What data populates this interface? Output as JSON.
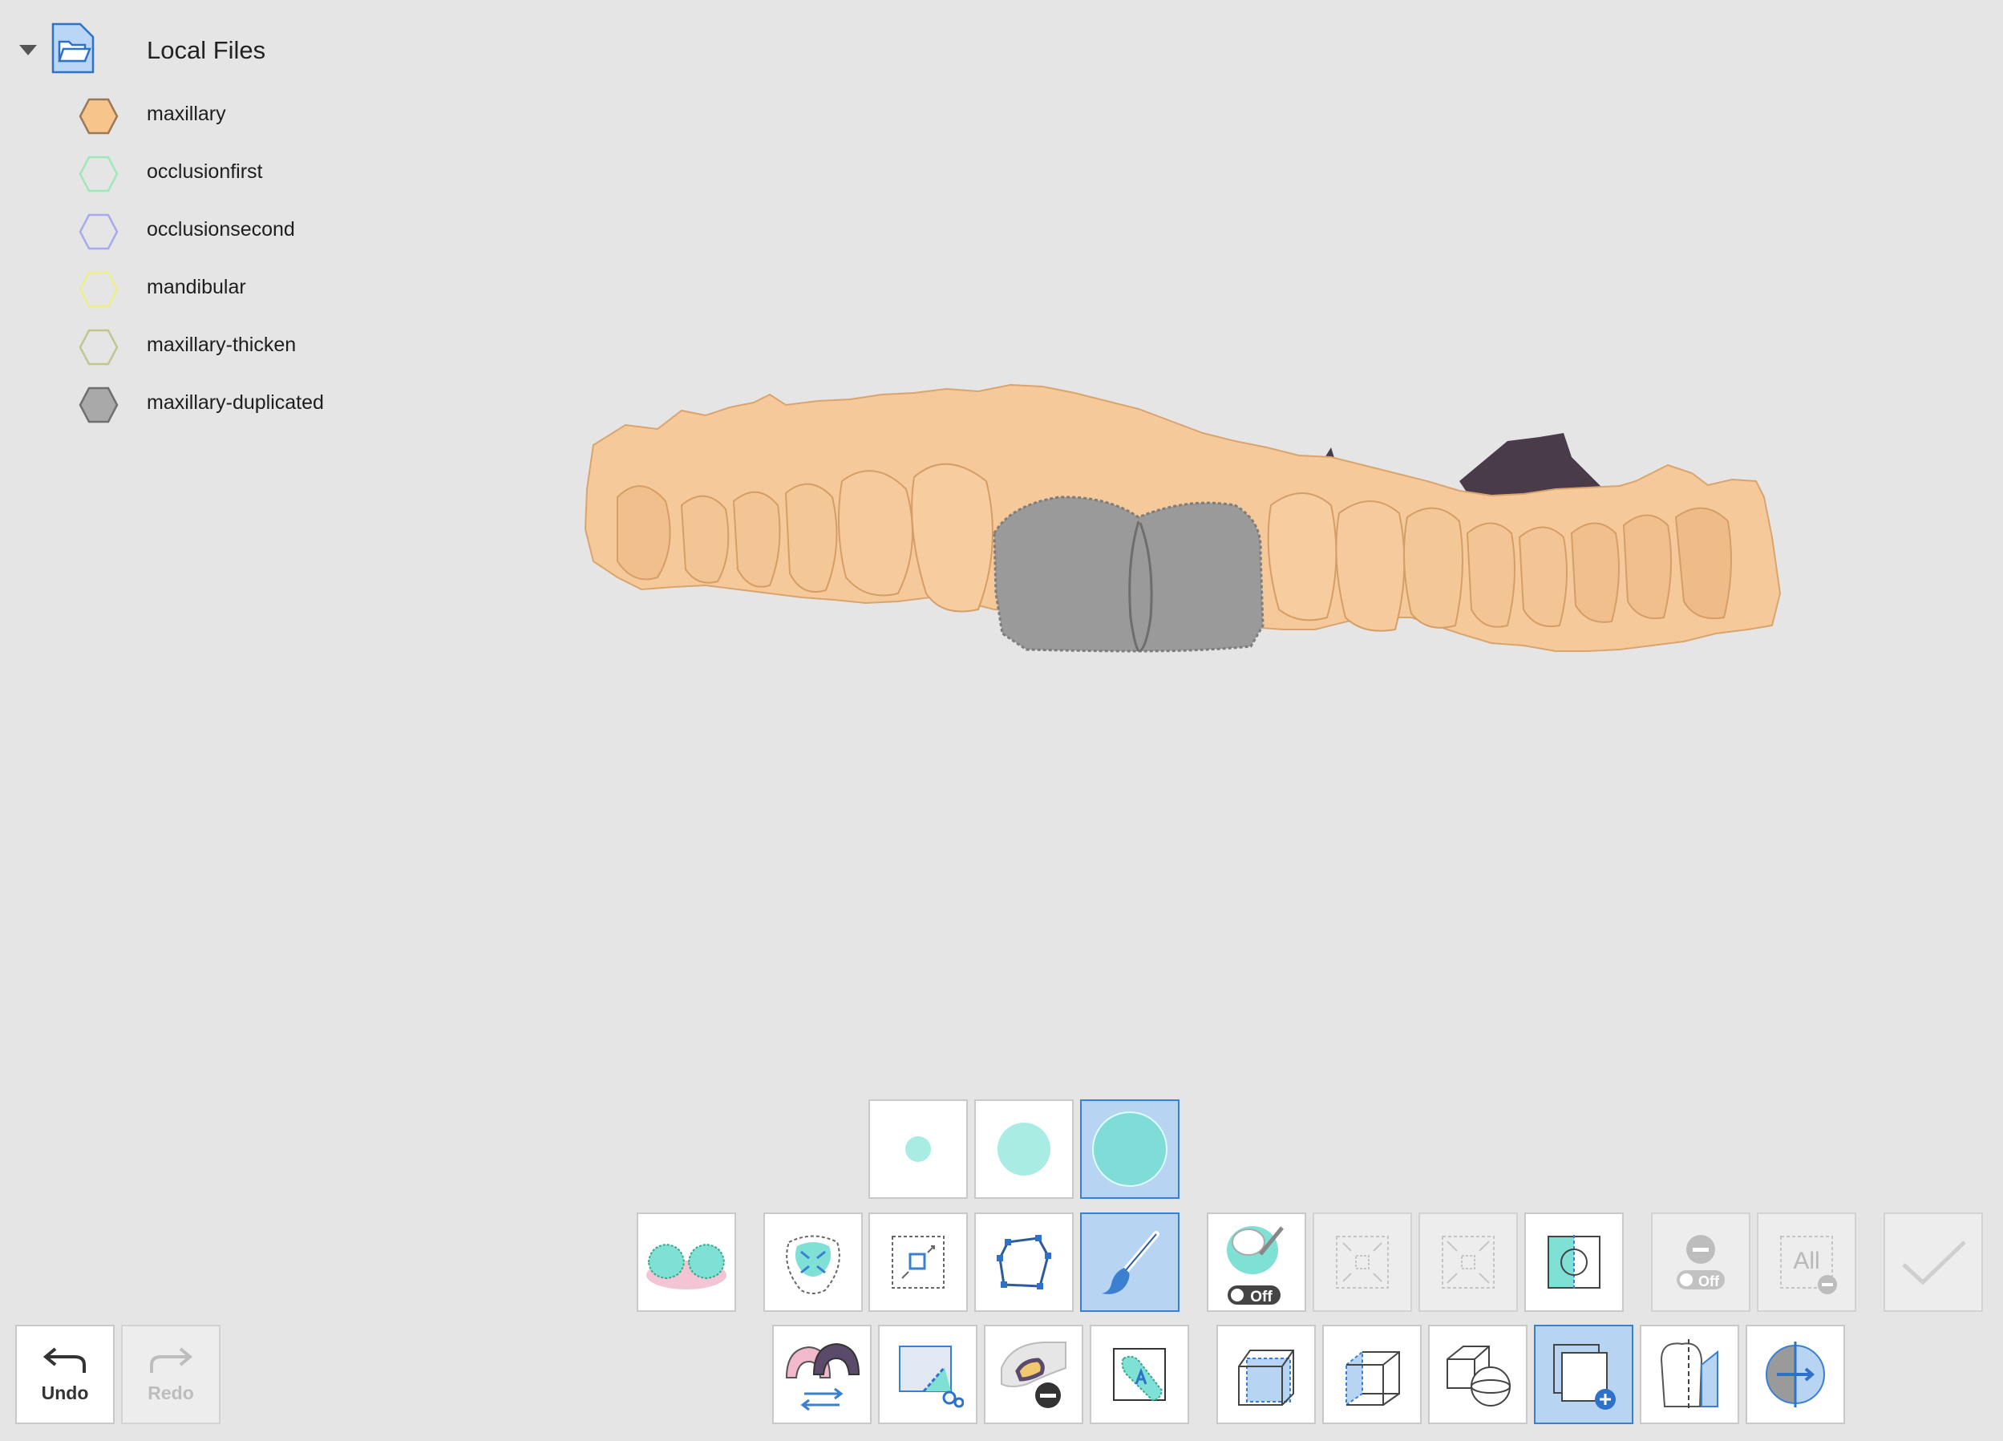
{
  "tree": {
    "root_label": "Local Files",
    "layers": [
      {
        "label": "maxillary",
        "fill": "#f7c48c",
        "stroke": "#9a7a55"
      },
      {
        "label": "occlusionfirst",
        "fill": "none",
        "stroke": "#9ee8b8"
      },
      {
        "label": "occlusionsecond",
        "fill": "none",
        "stroke": "#a9a9f0"
      },
      {
        "label": "mandibular",
        "fill": "none",
        "stroke": "#eeee88"
      },
      {
        "label": "maxillary-thicken",
        "fill": "none",
        "stroke": "#c2c58e"
      },
      {
        "label": "maxillary-duplicated",
        "fill": "#a9a9a9",
        "stroke": "#6f6f6f"
      }
    ]
  },
  "viewport": {
    "model_color": "#f6c99a",
    "selection_color": "#9a9a9a"
  },
  "toolbar": {
    "undo_label": "Undo",
    "redo_label": "Redo",
    "toggle_off_label": "Off",
    "all_label": "All",
    "brush_sizes": [
      "small",
      "medium",
      "large"
    ],
    "selected_brush_size": "large",
    "selection_tool_icons": [
      "both-jaws-icon",
      "select-all-icon",
      "box-select-icon",
      "polygon-select-icon",
      "brush-select-icon"
    ],
    "active_selection_tool": "brush-select-icon",
    "option_icons": [
      "surface-off-toggle-icon",
      "shrink-selection-icon",
      "expand-selection-icon",
      "invert-selection-icon",
      "hide-off-toggle-icon",
      "delete-all-icon",
      "apply-check-icon"
    ],
    "bottom_row_icons": [
      "swap-jaw-icon",
      "cut-region-icon",
      "remove-layer-icon",
      "label-tool-icon",
      "front-view-icon",
      "side-view-icon",
      "view-mode-icon",
      "new-layer-icon",
      "tooth-section-icon",
      "mirror-icon"
    ],
    "active_bottom_tool": "new-layer-icon",
    "accent": "#3a7fd0",
    "teal": "#7fe0d6"
  }
}
